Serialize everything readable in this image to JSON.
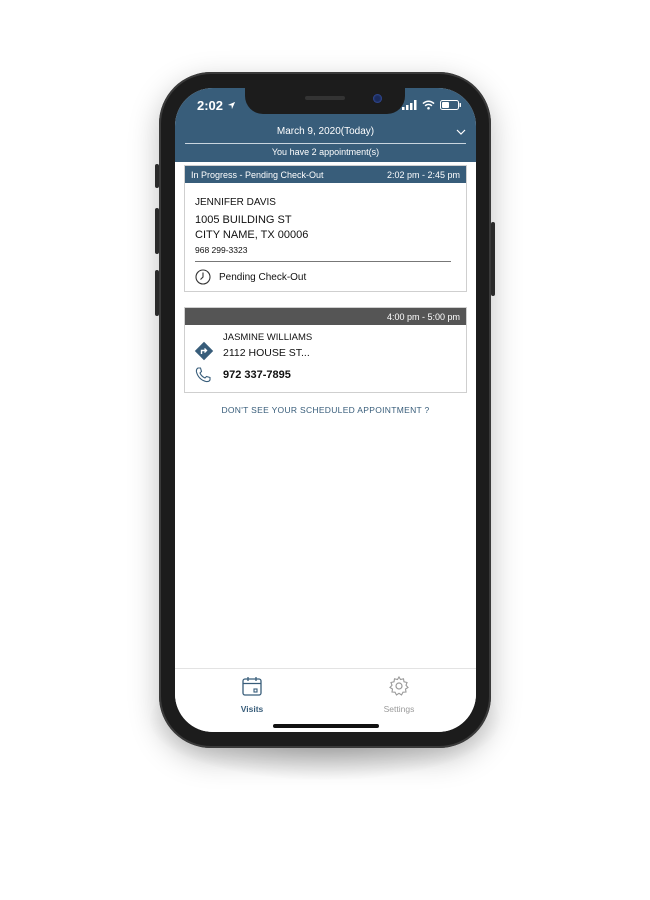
{
  "status_bar": {
    "time": "2:02"
  },
  "header": {
    "date": "March 9, 2020(Today)",
    "appointment_count": "You have 2 appointment(s)"
  },
  "appointments": [
    {
      "status": "In Progress - Pending Check-Out",
      "time_range": "2:02 pm - 2:45 pm",
      "name": "JENNIFER DAVIS",
      "address_line1": "1005 BUILDING ST",
      "address_line2": "CITY NAME, TX 00006",
      "phone": "968 299-3323",
      "action_label": "Pending Check-Out"
    },
    {
      "time_range": "4:00 pm - 5:00 pm",
      "name": "JASMINE WILLIAMS",
      "address": "2112 HOUSE ST...",
      "phone": "972 337-7895"
    }
  ],
  "missing_link": "DON'T SEE YOUR SCHEDULED APPOINTMENT ?",
  "tabs": [
    {
      "label": "Visits",
      "icon": "calendar-icon",
      "active": true
    },
    {
      "label": "Settings",
      "icon": "gear-icon",
      "active": false
    }
  ],
  "colors": {
    "primary": "#385d7a",
    "card2_header": "#555555"
  }
}
